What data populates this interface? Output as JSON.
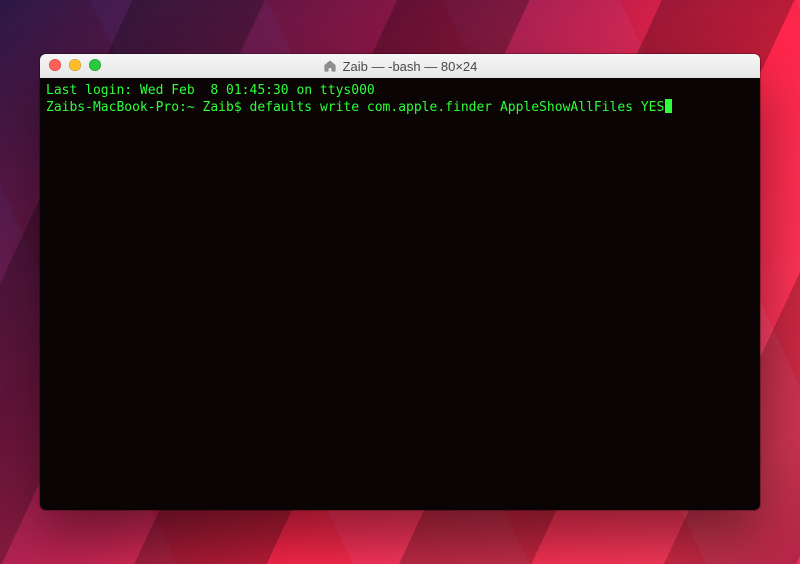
{
  "window": {
    "title": "Zaib — -bash — 80×24"
  },
  "terminal": {
    "line1": "Last login: Wed Feb  8 01:45:30 on ttys000",
    "prompt": "Zaibs-MacBook-Pro:~ Zaib$ ",
    "command": "defaults write com.apple.finder AppleShowAllFiles YES"
  },
  "colors": {
    "term_bg": "#0a0404",
    "term_fg": "#2cff3a"
  }
}
